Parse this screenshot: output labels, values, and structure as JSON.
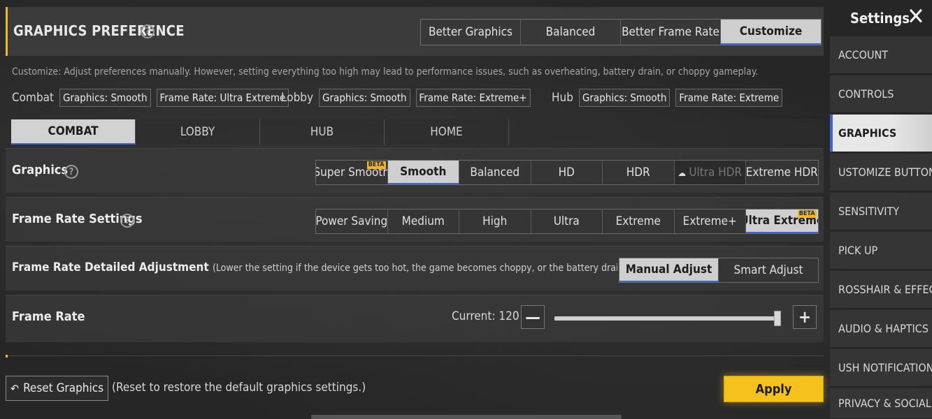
{
  "header": {
    "title": "GRAPHICS PREFERENCE",
    "help_icon": "question-circle-icon",
    "presets": [
      "Better Graphics",
      "Balanced",
      "Better Frame Rate",
      "Customize"
    ],
    "active_preset": "Customize"
  },
  "info_text": "Customize: Adjust preferences manually. However, setting everything too high may lead to performance issues, such as overheating, battery drain, or choppy gameplay.",
  "summary": {
    "combat": {
      "label": "Combat",
      "graphics": "Graphics: Smooth",
      "frame_rate": "Frame Rate: Ultra Extreme"
    },
    "lobby": {
      "label": "Lobby",
      "graphics": "Graphics: Smooth",
      "frame_rate": "Frame Rate: Extreme+"
    },
    "hub": {
      "label": "Hub",
      "graphics": "Graphics: Smooth",
      "frame_rate": "Frame Rate: Extreme"
    }
  },
  "tabs": [
    "COMBAT",
    "LOBBY",
    "HUB",
    "HOME"
  ],
  "active_tab": "COMBAT",
  "graphics": {
    "label": "Graphics",
    "options": [
      "Super Smooth",
      "Smooth",
      "Balanced",
      "HD",
      "HDR",
      "Ultra HDR",
      "Extreme HDR"
    ],
    "beta_badge": "BETA",
    "selected": "Smooth"
  },
  "frame_rate_settings": {
    "label": "Frame Rate Settings",
    "options": [
      "Power Saving",
      "Medium",
      "High",
      "Ultra",
      "Extreme",
      "Extreme+",
      "Ultra Extreme"
    ],
    "beta_badge": "BETA",
    "selected": "Ultra Extreme"
  },
  "frame_rate_detailed": {
    "label": "Frame Rate Detailed Adjustment",
    "note": "(Lower the setting if the device gets too hot, the game becomes choppy, or the battery drains too quic",
    "options": [
      "Manual Adjust",
      "Smart Adjust"
    ],
    "selected": "Manual Adjust"
  },
  "frame_rate": {
    "label": "Frame Rate",
    "current": "Current: 120",
    "slider_fraction": 1.0
  },
  "footer": {
    "reset_label": "Reset Graphics",
    "reset_note": "(Reset to restore the default graphics settings.)",
    "apply_label": "Apply"
  },
  "sidebar": {
    "title": "Settings",
    "items": [
      "ACCOUNT",
      "CONTROLS",
      "GRAPHICS",
      "USTOMIZE BUTTONS",
      "SENSITIVITY",
      "PICK UP",
      "ROSSHAIR & EFFEC",
      "AUDIO & HAPTICS",
      "USH NOTIFICATIONS",
      "PRIVACY & SOCIAL"
    ],
    "active": "GRAPHICS"
  },
  "colors": {
    "accent_blue": "#3f63d9",
    "accent_yellow": "#f5c21d"
  }
}
